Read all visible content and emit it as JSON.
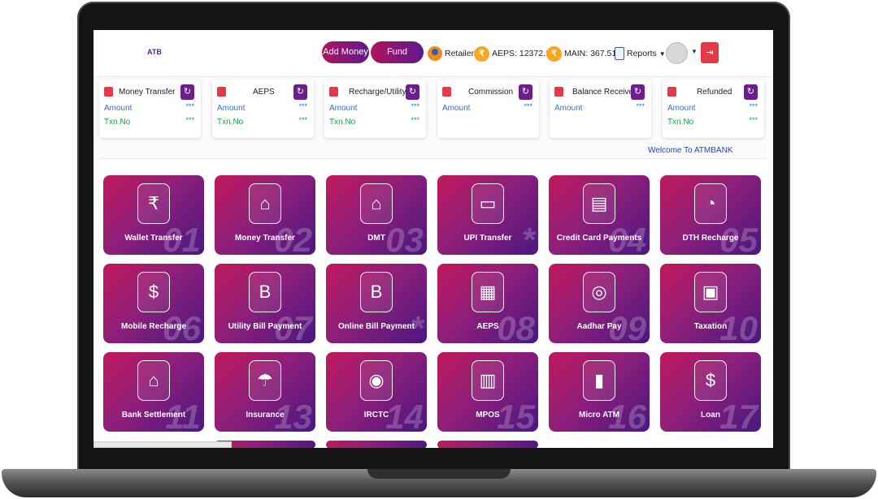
{
  "header": {
    "logo_a": "A",
    "logo_b": "TB",
    "add_money": "Add Money",
    "fund_request": "Fund Request",
    "retailer": "Retailer",
    "aeps_balance": "AEPS: 12372.19",
    "main_balance": "MAIN: 367.51",
    "reports": "Reports",
    "coin_symbol": "₹",
    "logout_symbol": "⇥"
  },
  "stats": [
    {
      "title": "Money Transfer",
      "amount_label": "Amount",
      "txn_label": "Txn.No",
      "amount_value": "***",
      "txn_value": "***"
    },
    {
      "title": "AEPS",
      "amount_label": "Amount",
      "txn_label": "Txn.No",
      "amount_value": "***",
      "txn_value": "***"
    },
    {
      "title": "Recharge/Utility",
      "amount_label": "Amount",
      "txn_label": "Txn.No",
      "amount_value": "***",
      "txn_value": "***"
    },
    {
      "title": "Commission",
      "amount_label": "Amount",
      "amount_value": "***"
    },
    {
      "title": "Balance Received",
      "amount_label": "Amount",
      "amount_value": "***"
    },
    {
      "title": "Refunded",
      "amount_label": "Amount",
      "txn_label": "Txn.No",
      "amount_value": "***",
      "txn_value": "***"
    }
  ],
  "welcome": "Welcome To ATMBANK",
  "tiles": [
    {
      "label": "Wallet Transfer",
      "num": "01",
      "icon": "₹"
    },
    {
      "label": "Money Transfer",
      "num": "02",
      "icon": "⌂"
    },
    {
      "label": "DMT",
      "num": "03",
      "icon": "⌂"
    },
    {
      "label": "UPI Transfer",
      "num": "*",
      "icon": "▭"
    },
    {
      "label": "Credit Card Payments",
      "num": "04",
      "icon": "▤"
    },
    {
      "label": "DTH Recharge",
      "num": "05",
      "icon": "◔"
    },
    {
      "label": "Mobile Recharge",
      "num": "06",
      "icon": "$"
    },
    {
      "label": "Utility Bill Payment",
      "num": "07",
      "icon": "B"
    },
    {
      "label": "Online Bill Payment",
      "num": "*",
      "icon": "B"
    },
    {
      "label": "AEPS",
      "num": "08",
      "icon": "▦"
    },
    {
      "label": "Aadhar Pay",
      "num": "09",
      "icon": "◎"
    },
    {
      "label": "Taxation",
      "num": "10",
      "icon": "▣"
    },
    {
      "label": "Bank Settlement",
      "num": "11",
      "icon": "⌂"
    },
    {
      "label": "Insurance",
      "num": "13",
      "icon": "☂"
    },
    {
      "label": "IRCTC",
      "num": "14",
      "icon": "◉"
    },
    {
      "label": "MPOS",
      "num": "15",
      "icon": "▥"
    },
    {
      "label": "Micro ATM",
      "num": "16",
      "icon": "▮"
    },
    {
      "label": "Loan",
      "num": "17",
      "icon": "$"
    }
  ]
}
